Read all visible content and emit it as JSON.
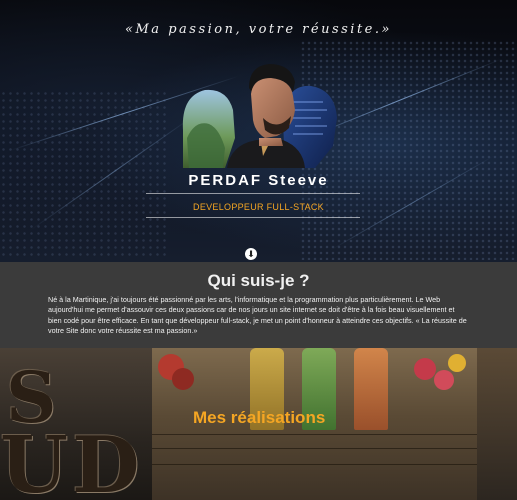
{
  "hero": {
    "slogan": "«Ma passion, votre réussite.»",
    "name": "PERDAF Steeve",
    "role": "DEVELOPPEUR FULL-STACK",
    "scroll_icon": "arrow-down-circle-icon"
  },
  "about": {
    "title": "Qui suis-je ?",
    "text": "Né à la Martinique, j'ai toujours été passionné par les arts, l'informatique et la programmation plus particulièrement. Le Web aujourd'hui me permet d'assouvir ces deux passions car de nos jours un site internet se doit d'être à la fois beau visuellement et bien codé pour être efficace. En tant que développeur full-stack, je met un point d'honneur à atteindre ces objectifs. « La réussite de votre Site donc votre réussite est ma passion.»"
  },
  "works": {
    "title": "Mes réalisations"
  },
  "colors": {
    "accent": "#f5a623",
    "about_bg": "#3b3b3b",
    "hero_bg": "#0e1320"
  }
}
